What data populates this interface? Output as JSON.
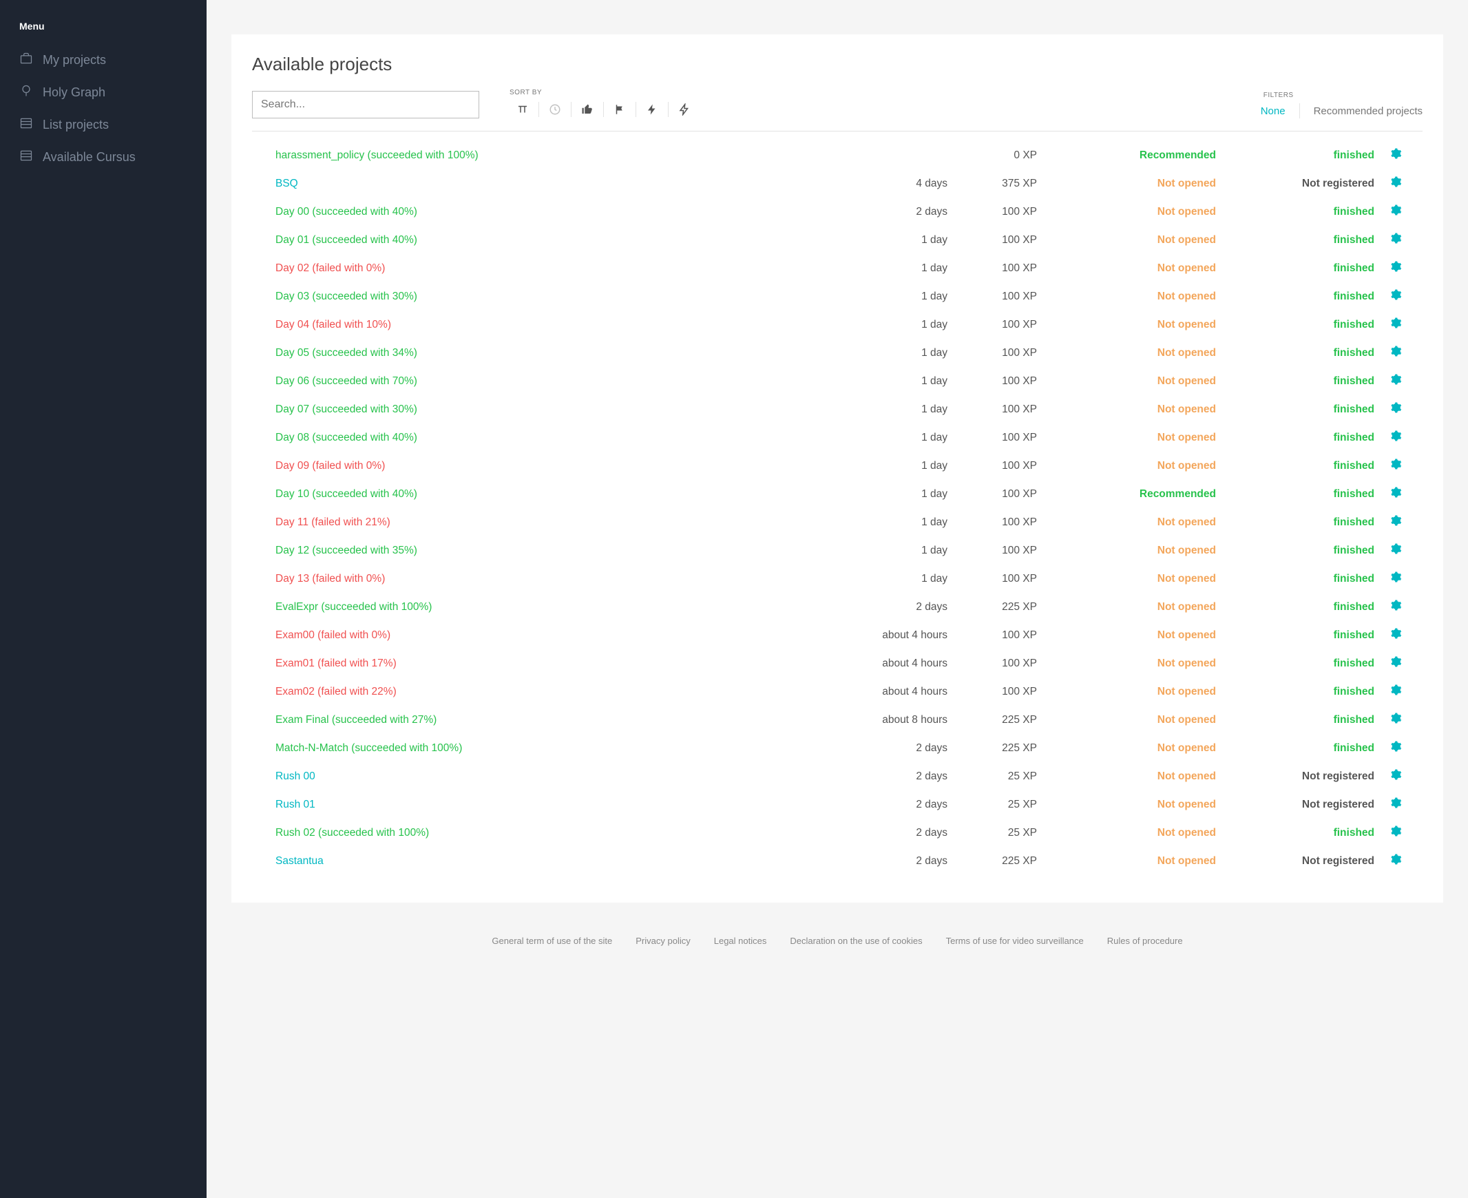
{
  "sidebar": {
    "title": "Menu",
    "items": [
      {
        "label": "My projects",
        "icon": "briefcase-icon"
      },
      {
        "label": "Holy Graph",
        "icon": "balloon-icon"
      },
      {
        "label": "List projects",
        "icon": "list-icon"
      },
      {
        "label": "Available Cursus",
        "icon": "list-icon"
      }
    ]
  },
  "header": {
    "page_title": "Available projects",
    "search_placeholder": "Search...",
    "sort_label": "SORT BY",
    "filters_label": "FILTERS",
    "filter_none": "None",
    "filter_recommended": "Recommended projects"
  },
  "projects": [
    {
      "name": "harassment_policy (succeeded with 100%)",
      "name_style": "success",
      "duration": "",
      "xp": "0 XP",
      "rec": "Recommended",
      "rec_style": "recommended",
      "status": "finished",
      "status_style": "finished"
    },
    {
      "name": "BSQ",
      "name_style": "link",
      "duration": "4 days",
      "xp": "375 XP",
      "rec": "Not opened",
      "rec_style": "notopened",
      "status": "Not registered",
      "status_style": "notreg"
    },
    {
      "name": "Day 00 (succeeded with 40%)",
      "name_style": "success",
      "duration": "2 days",
      "xp": "100 XP",
      "rec": "Not opened",
      "rec_style": "notopened",
      "status": "finished",
      "status_style": "finished"
    },
    {
      "name": "Day 01 (succeeded with 40%)",
      "name_style": "success",
      "duration": "1 day",
      "xp": "100 XP",
      "rec": "Not opened",
      "rec_style": "notopened",
      "status": "finished",
      "status_style": "finished"
    },
    {
      "name": "Day 02 (failed with 0%)",
      "name_style": "fail",
      "duration": "1 day",
      "xp": "100 XP",
      "rec": "Not opened",
      "rec_style": "notopened",
      "status": "finished",
      "status_style": "finished"
    },
    {
      "name": "Day 03 (succeeded with 30%)",
      "name_style": "success",
      "duration": "1 day",
      "xp": "100 XP",
      "rec": "Not opened",
      "rec_style": "notopened",
      "status": "finished",
      "status_style": "finished"
    },
    {
      "name": "Day 04 (failed with 10%)",
      "name_style": "fail",
      "duration": "1 day",
      "xp": "100 XP",
      "rec": "Not opened",
      "rec_style": "notopened",
      "status": "finished",
      "status_style": "finished"
    },
    {
      "name": "Day 05 (succeeded with 34%)",
      "name_style": "success",
      "duration": "1 day",
      "xp": "100 XP",
      "rec": "Not opened",
      "rec_style": "notopened",
      "status": "finished",
      "status_style": "finished"
    },
    {
      "name": "Day 06 (succeeded with 70%)",
      "name_style": "success",
      "duration": "1 day",
      "xp": "100 XP",
      "rec": "Not opened",
      "rec_style": "notopened",
      "status": "finished",
      "status_style": "finished"
    },
    {
      "name": "Day 07 (succeeded with 30%)",
      "name_style": "success",
      "duration": "1 day",
      "xp": "100 XP",
      "rec": "Not opened",
      "rec_style": "notopened",
      "status": "finished",
      "status_style": "finished"
    },
    {
      "name": "Day 08 (succeeded with 40%)",
      "name_style": "success",
      "duration": "1 day",
      "xp": "100 XP",
      "rec": "Not opened",
      "rec_style": "notopened",
      "status": "finished",
      "status_style": "finished"
    },
    {
      "name": "Day 09 (failed with 0%)",
      "name_style": "fail",
      "duration": "1 day",
      "xp": "100 XP",
      "rec": "Not opened",
      "rec_style": "notopened",
      "status": "finished",
      "status_style": "finished"
    },
    {
      "name": "Day 10 (succeeded with 40%)",
      "name_style": "success",
      "duration": "1 day",
      "xp": "100 XP",
      "rec": "Recommended",
      "rec_style": "recommended",
      "status": "finished",
      "status_style": "finished"
    },
    {
      "name": "Day 11 (failed with 21%)",
      "name_style": "fail",
      "duration": "1 day",
      "xp": "100 XP",
      "rec": "Not opened",
      "rec_style": "notopened",
      "status": "finished",
      "status_style": "finished"
    },
    {
      "name": "Day 12 (succeeded with 35%)",
      "name_style": "success",
      "duration": "1 day",
      "xp": "100 XP",
      "rec": "Not opened",
      "rec_style": "notopened",
      "status": "finished",
      "status_style": "finished"
    },
    {
      "name": "Day 13 (failed with 0%)",
      "name_style": "fail",
      "duration": "1 day",
      "xp": "100 XP",
      "rec": "Not opened",
      "rec_style": "notopened",
      "status": "finished",
      "status_style": "finished"
    },
    {
      "name": "EvalExpr (succeeded with 100%)",
      "name_style": "success",
      "duration": "2 days",
      "xp": "225 XP",
      "rec": "Not opened",
      "rec_style": "notopened",
      "status": "finished",
      "status_style": "finished"
    },
    {
      "name": "Exam00 (failed with 0%)",
      "name_style": "fail",
      "duration": "about 4 hours",
      "xp": "100 XP",
      "rec": "Not opened",
      "rec_style": "notopened",
      "status": "finished",
      "status_style": "finished"
    },
    {
      "name": "Exam01 (failed with 17%)",
      "name_style": "fail",
      "duration": "about 4 hours",
      "xp": "100 XP",
      "rec": "Not opened",
      "rec_style": "notopened",
      "status": "finished",
      "status_style": "finished"
    },
    {
      "name": "Exam02 (failed with 22%)",
      "name_style": "fail",
      "duration": "about 4 hours",
      "xp": "100 XP",
      "rec": "Not opened",
      "rec_style": "notopened",
      "status": "finished",
      "status_style": "finished"
    },
    {
      "name": "Exam Final (succeeded with 27%)",
      "name_style": "success",
      "duration": "about 8 hours",
      "xp": "225 XP",
      "rec": "Not opened",
      "rec_style": "notopened",
      "status": "finished",
      "status_style": "finished"
    },
    {
      "name": "Match-N-Match (succeeded with 100%)",
      "name_style": "success",
      "duration": "2 days",
      "xp": "225 XP",
      "rec": "Not opened",
      "rec_style": "notopened",
      "status": "finished",
      "status_style": "finished"
    },
    {
      "name": "Rush 00",
      "name_style": "link",
      "duration": "2 days",
      "xp": "25 XP",
      "rec": "Not opened",
      "rec_style": "notopened",
      "status": "Not registered",
      "status_style": "notreg"
    },
    {
      "name": "Rush 01",
      "name_style": "link",
      "duration": "2 days",
      "xp": "25 XP",
      "rec": "Not opened",
      "rec_style": "notopened",
      "status": "Not registered",
      "status_style": "notreg"
    },
    {
      "name": "Rush 02 (succeeded with 100%)",
      "name_style": "success",
      "duration": "2 days",
      "xp": "25 XP",
      "rec": "Not opened",
      "rec_style": "notopened",
      "status": "finished",
      "status_style": "finished"
    },
    {
      "name": "Sastantua",
      "name_style": "link",
      "duration": "2 days",
      "xp": "225 XP",
      "rec": "Not opened",
      "rec_style": "notopened",
      "status": "Not registered",
      "status_style": "notreg"
    }
  ],
  "footer": {
    "links": [
      "General term of use of the site",
      "Privacy policy",
      "Legal notices",
      "Declaration on the use of cookies",
      "Terms of use for video surveillance",
      "Rules of procedure"
    ]
  }
}
